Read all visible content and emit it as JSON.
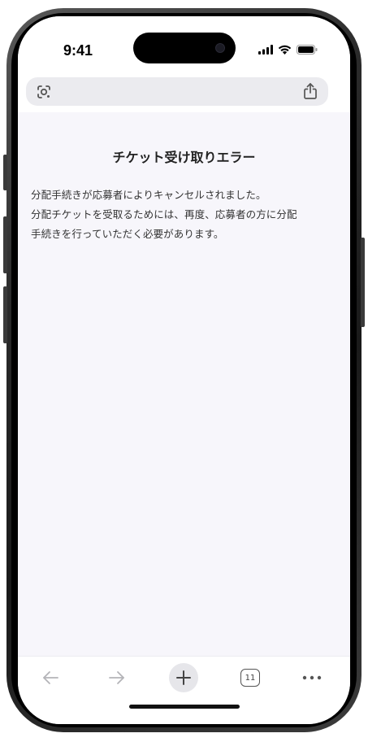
{
  "status_bar": {
    "time": "9:41",
    "icons": [
      "cellular-signal-icon",
      "wifi-icon",
      "battery-icon"
    ]
  },
  "url_bar": {
    "left_icon": "google-lens-icon",
    "right_icon": "share-icon"
  },
  "page": {
    "title": "チケット受け取りエラー",
    "lines": [
      "分配手続きが応募者によりキャンセルされました。",
      "分配チケットを受取るためには、再度、応募者の方に分配",
      "手続きを行っていただく必要があります。"
    ]
  },
  "toolbar": {
    "back_icon": "back-arrow-icon",
    "forward_icon": "forward-arrow-icon",
    "new_tab_icon": "plus-icon",
    "tab_count": "11",
    "menu_icon": "more-dots-icon"
  },
  "colors": {
    "page_background": "#f7f6fb",
    "url_bar_background": "#ebebef",
    "text_primary": "#222222"
  }
}
